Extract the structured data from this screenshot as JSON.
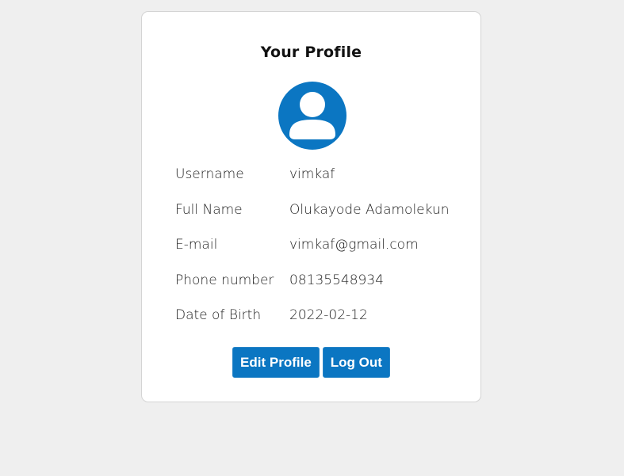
{
  "profile": {
    "title": "Your Profile",
    "avatar_icon": "user-avatar-icon",
    "fields": [
      {
        "label": "Username",
        "value": "vimkaf"
      },
      {
        "label": "Full Name",
        "value": "Olukayode Adamolekun"
      },
      {
        "label": "E-mail",
        "value": "vimkaf@gmail.com"
      },
      {
        "label": "Phone number",
        "value": "08135548934"
      },
      {
        "label": "Date of Birth",
        "value": "2022-02-12"
      }
    ],
    "actions": {
      "edit_label": "Edit Profile",
      "logout_label": "Log Out"
    }
  },
  "colors": {
    "accent": "#0b76c2",
    "background": "#efefef",
    "card": "#ffffff"
  }
}
